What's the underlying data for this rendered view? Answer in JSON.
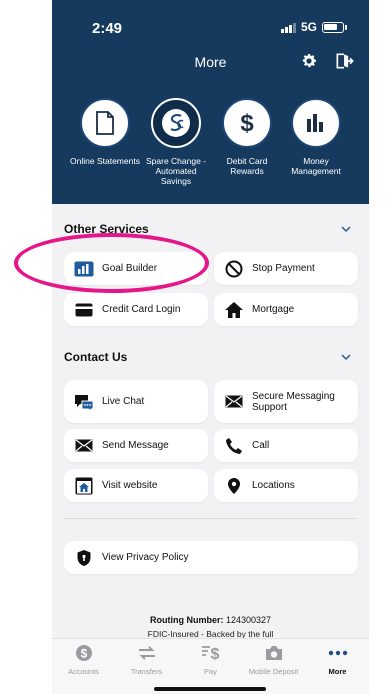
{
  "status": {
    "time": "2:49",
    "network": "5G"
  },
  "nav": {
    "title": "More"
  },
  "quick_actions": [
    {
      "label": "Online Statements",
      "icon": "document-icon"
    },
    {
      "label": "Spare Change - Automated Savings",
      "icon": "spare-change-logo-icon"
    },
    {
      "label": "Debit Card Rewards",
      "icon": "dollar-icon"
    },
    {
      "label": "Money Management",
      "icon": "bar-chart-icon"
    }
  ],
  "other_services": {
    "title": "Other Services",
    "items": [
      {
        "label": "Goal Builder",
        "icon": "goal-chart-icon"
      },
      {
        "label": "Stop Payment",
        "icon": "prohibited-icon"
      },
      {
        "label": "Credit Card Login",
        "icon": "credit-card-icon"
      },
      {
        "label": "Mortgage",
        "icon": "house-icon"
      }
    ]
  },
  "contact_us": {
    "title": "Contact Us",
    "items": [
      {
        "label": "Live Chat",
        "icon": "chat-icon"
      },
      {
        "label": "Secure Messaging Support",
        "icon": "envelope-icon"
      },
      {
        "label": "Send Message",
        "icon": "envelope-icon"
      },
      {
        "label": "Call",
        "icon": "phone-icon"
      },
      {
        "label": "Visit website",
        "icon": "website-home-icon"
      },
      {
        "label": "Locations",
        "icon": "location-pin-icon"
      }
    ]
  },
  "privacy": {
    "label": "View Privacy Policy",
    "icon": "shield-icon"
  },
  "footer": {
    "routing_label": "Routing Number:",
    "routing_number": "124300327",
    "fdic": "FDIC-Insured - Backed by the full"
  },
  "tabs": [
    {
      "label": "Accounts",
      "icon": "dollar-coin-icon",
      "active": false
    },
    {
      "label": "Transfers",
      "icon": "transfer-arrows-icon",
      "active": false
    },
    {
      "label": "Pay",
      "icon": "pay-icon",
      "active": false
    },
    {
      "label": "Mobile Deposit",
      "icon": "camera-icon",
      "active": false
    },
    {
      "label": "More",
      "icon": "more-dots-icon",
      "active": true
    }
  ],
  "colors": {
    "header_bg": "#163a5e",
    "accent_icon": "#1e5c9c",
    "annotation": "#e5168a"
  }
}
